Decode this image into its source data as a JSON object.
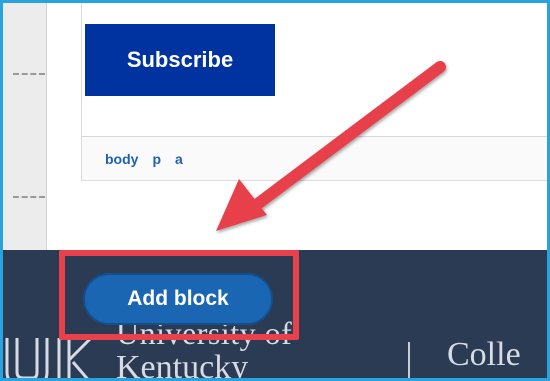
{
  "subscribe_button": {
    "label": "Subscribe",
    "color": "#0033a0"
  },
  "path_bar": {
    "items": [
      "body",
      "p",
      "a"
    ],
    "link_color": "#1f62b4"
  },
  "add_block_button": {
    "label": "Add block",
    "color": "#1a66b3"
  },
  "footer": {
    "background": "#2c3b54",
    "university_line": "University of",
    "university_line_2": "Kentucky",
    "college_text": "Colle"
  },
  "annotation": {
    "color": "#e8414b",
    "icons": [
      "red-arrow-icon",
      "red-highlight-box"
    ]
  }
}
